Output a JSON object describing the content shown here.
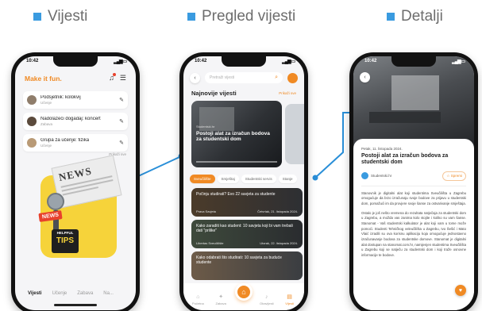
{
  "headings": {
    "list": "Vijesti",
    "overview": "Pregled vijesti",
    "detail": "Detalji"
  },
  "colors": {
    "accent": "#f08a24",
    "heading_square": "#3a9be0",
    "alert": "#e8412c"
  },
  "status": {
    "time": "10:42"
  },
  "phone1": {
    "brand": "Make it fun.",
    "notifications": [
      {
        "title": "Podsjetnik: kolokvij",
        "subtitle": "Učenje"
      },
      {
        "title": "Nadolazeći događaj: koncert",
        "subtitle": "Zabava"
      },
      {
        "title": "Grupa za učenje: fizika",
        "subtitle": "Učenje"
      }
    ],
    "more_link": "Prikaži sve",
    "illustration": {
      "newspaper_word": "NEWS",
      "tag": "NEWS",
      "tips_small": "HELPFUL",
      "tips": "TIPS"
    },
    "tabs": [
      "Vijesti",
      "Učenje",
      "Zabava",
      "Na..."
    ]
  },
  "phone2": {
    "search_placeholder": "Pretraži vijesti",
    "section_title": "Najnovije vijesti",
    "section_link": "Prikaži sve",
    "hero": {
      "source": "Studentski.hr",
      "title": "Postoji alat za izračun bodova za studentski dom"
    },
    "chips": [
      "Sveučilište",
      "Smještaj",
      "Studentski servis",
      "Stanje"
    ],
    "cards": [
      {
        "title": "Počinju studirati? Evo 22 savjeta za studente",
        "source": "Prava Savjeta",
        "date": "Četvrtak, 21. listopada 2024."
      },
      {
        "title": "Kako zaraditi kao student: 10 savjeta koji bi vam trebali dati \"prilike\"",
        "source": "Libertas Sveučilište",
        "date": "Utorak, 22. listopada 2024."
      },
      {
        "title": "Kako odabrati što studirati: 10 savjeta za buduće studente",
        "source": "",
        "date": ""
      }
    ],
    "nav": [
      "Početna",
      "Zabava",
      "",
      "Obavijesti",
      "Vijesti"
    ]
  },
  "phone3": {
    "date": "Petak, 11. listopada 2024.",
    "title": "Postoji alat za izračun bodova za studentski dom",
    "author": "Studentski.hr",
    "favorite": "Spremi",
    "paragraphs": [
      "Stanovnik je digitalni alat koji studentima Sveučilišta u Zagrebu omogućuje da brzo izračunaju svoje bodove za prijavu u studentski dom, pomažući im da provjere svoje šanse za ostvarivanje smještaja.",
      "Ostalo je još nešto vremena do rezultata natječaja za studentski dom u Zagrebu, a možda vas zanima kolo stojite i koliko su vam šanse. Stanomat - Vaš studentski kalkulator je alat koji vam u tome može pomoći. Studenti Tehničkog veleučilišta u Zagrebu, Ivo Šešić i Mato Vlaić izradili su ova korisnu aplikaciju koja omogućuje jednostavno izračunavanje bodova za studentske domove. Stanomat je digitalni alat dostupan na stanomat.com.hr, namijenjen studentima Sveučilišta u Zagrebu koji se natječu za studentski dom i koji traže osnovne informacije te bodove."
    ]
  }
}
